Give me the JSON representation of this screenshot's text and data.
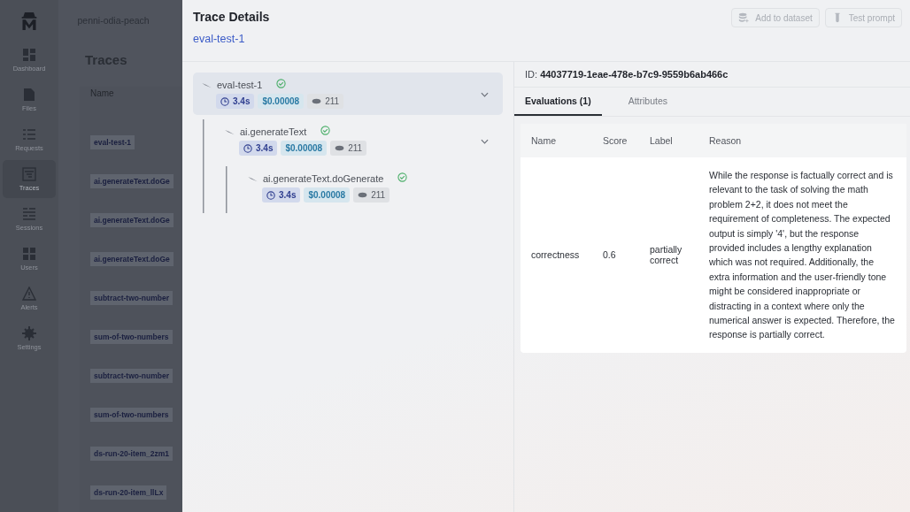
{
  "sidebar": {
    "items": [
      {
        "label": "Dashboard",
        "selected": false
      },
      {
        "label": "Files",
        "selected": false
      },
      {
        "label": "Requests",
        "selected": false
      },
      {
        "label": "Traces",
        "selected": true
      },
      {
        "label": "Sessions",
        "selected": false
      },
      {
        "label": "Users",
        "selected": false
      },
      {
        "label": "Alerts",
        "selected": false
      },
      {
        "label": "Settings",
        "selected": false
      }
    ]
  },
  "project": "penni-odia-peach",
  "page_title": "Traces",
  "traces_table": {
    "columns": [
      "Name"
    ],
    "rows": [
      "eval-test-1",
      "ai.generateText.doGe",
      "ai.generateText.doGe",
      "ai.generateText.doGe",
      "subtract-two-number",
      "sum-of-two-numbers",
      "subtract-two-number",
      "sum-of-two-numbers",
      "ds-run-20-item_2zm1",
      "ds-run-20-item_llLx"
    ]
  },
  "drawer": {
    "title": "Trace Details",
    "trace_link": "eval-test-1",
    "buttons": [
      {
        "label": "Add to dataset",
        "disabled": true
      },
      {
        "label": "Test prompt",
        "disabled": true
      }
    ],
    "tree": [
      {
        "name": "eval-test-1",
        "success": true,
        "duration": "3.4s",
        "cost": "$0.00008",
        "tokens": "211",
        "selected": true,
        "expanded": true,
        "children": [
          {
            "name": "ai.generateText",
            "success": true,
            "duration": "3.4s",
            "cost": "$0.00008",
            "tokens": "211",
            "selected": false,
            "expanded": true,
            "children": [
              {
                "name": "ai.generateText.doGenerate",
                "success": true,
                "duration": "3.4s",
                "cost": "$0.00008",
                "tokens": "211",
                "selected": false
              }
            ]
          }
        ]
      }
    ],
    "id_label": "ID:",
    "id_value": "44037719-1eae-478e-b7c9-9559b6ab466c",
    "tabs": [
      {
        "label": "Evaluations (1)",
        "selected": true
      },
      {
        "label": "Attributes",
        "selected": false
      }
    ],
    "evaluations": {
      "columns": [
        "Name",
        "Score",
        "Label",
        "Reason"
      ],
      "rows": [
        {
          "name": "correctness",
          "score": "0.6",
          "label": "partially correct",
          "reason": "While the response is factually correct and is relevant to the task of solving the math problem 2+2, it does not meet the requirement of completeness. The expected output is simply '4', but the response provided includes a lengthy explanation which was not required. Additionally, the extra information and the user-friendly tone might be considered inappropriate or distracting in a context where only the numerical answer is expected. Therefore, the response is partially correct."
        }
      ]
    }
  }
}
